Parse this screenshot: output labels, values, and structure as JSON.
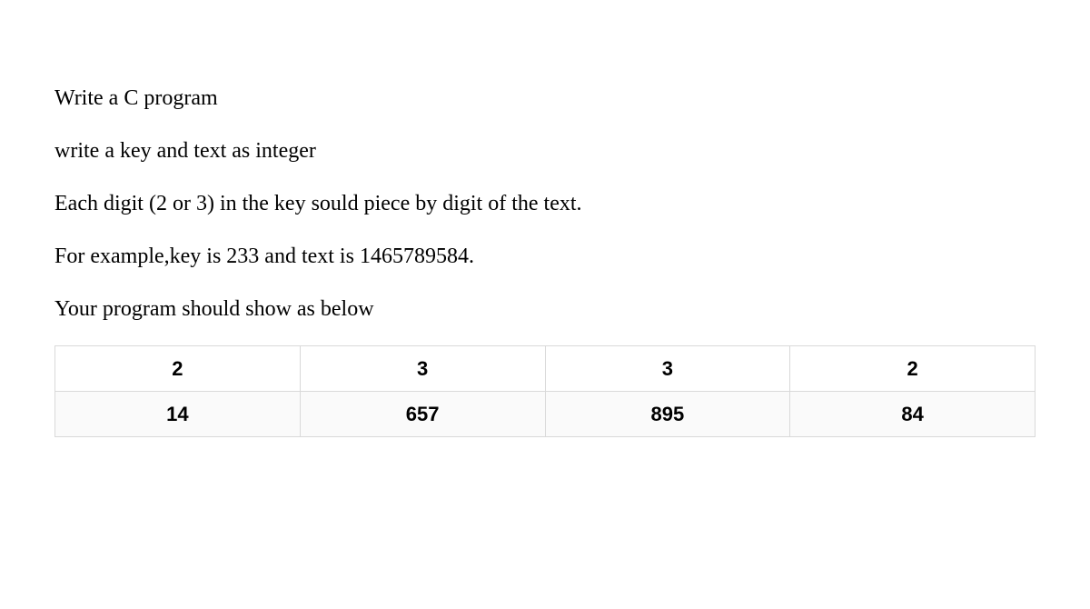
{
  "paragraphs": {
    "p1": "Write a C program",
    "p2": "write a key and text as integer",
    "p3": "Each digit (2 or 3) in the key sould piece by digit of the text.",
    "p4": "For example,key is 233 and text is 1465789584.",
    "p5": "Your program should show as below"
  },
  "table": {
    "row1": {
      "c1": "2",
      "c2": "3",
      "c3": "3",
      "c4": "2"
    },
    "row2": {
      "c1": "14",
      "c2": "657",
      "c3": "895",
      "c4": "84"
    }
  }
}
